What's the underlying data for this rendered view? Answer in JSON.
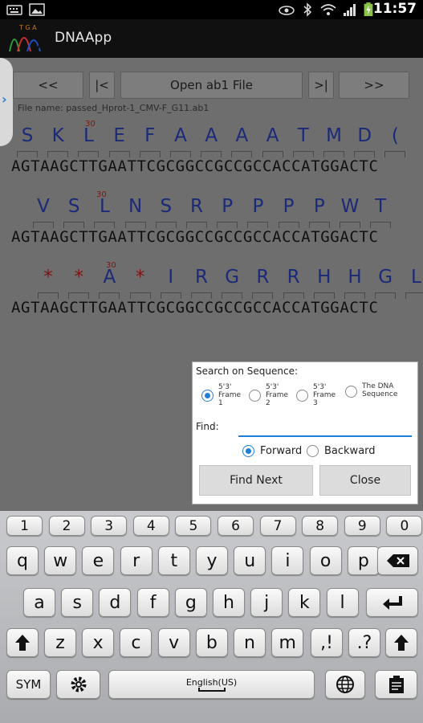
{
  "status_bar": {
    "time": "11:57",
    "icons": [
      "keyboard-icon",
      "image-icon",
      "eye-icon",
      "bluetooth-icon",
      "wifi-icon",
      "signal-icon",
      "battery-icon"
    ]
  },
  "app": {
    "title": "DNAApp",
    "logo_letters": "T G A"
  },
  "nav": {
    "first": "<<",
    "start": "|<",
    "open": "Open ab1 File",
    "end": ">|",
    "last": ">>"
  },
  "file_name": "File name: passed_Hprot-1_CMV-F_G11.ab1",
  "frames": [
    {
      "position_label": "30",
      "amino_acids": [
        "S",
        "K",
        "L",
        "E",
        "F",
        "A",
        "A",
        "A",
        "A",
        "T",
        "M",
        "D",
        "("
      ],
      "dna": "AGTAAGCTTGAATTCGCGGCCGCCGCCACCATGGACTC"
    },
    {
      "position_label": "30",
      "amino_acids": [
        "V",
        "S",
        "L",
        "N",
        "S",
        "R",
        "P",
        "P",
        "P",
        "P",
        "W",
        "T"
      ],
      "dna": "AGTAAGCTTGAATTCGCGGCCGCCGCCACCATGGACTC"
    },
    {
      "position_label": "30",
      "amino_acids": [
        "*",
        "*",
        "A",
        "*",
        "I",
        "R",
        "G",
        "R",
        "R",
        "H",
        "H",
        "G",
        "L"
      ],
      "dna": "AGTAAGCTTGAATTCGCGGCCGCCGCCACCATGGACTC"
    }
  ],
  "dialog": {
    "heading": "Search on Sequence:",
    "options": [
      {
        "line1": "5'3'",
        "line2": "Frame",
        "line3": "1",
        "selected": true
      },
      {
        "line1": "5'3'",
        "line2": "Frame",
        "line3": "2",
        "selected": false
      },
      {
        "line1": "5'3'",
        "line2": "Frame",
        "line3": "3",
        "selected": false
      },
      {
        "line1": "The DNA",
        "line2": "Sequence",
        "line3": "",
        "selected": false
      }
    ],
    "find_label": "Find:",
    "find_value": "",
    "forward_label": "Forward",
    "backward_label": "Backward",
    "direction": "Forward",
    "find_next": "Find Next",
    "close": "Close"
  },
  "keyboard": {
    "numbers": [
      "1",
      "2",
      "3",
      "4",
      "5",
      "6",
      "7",
      "8",
      "9",
      "0"
    ],
    "row1": [
      "q",
      "w",
      "e",
      "r",
      "t",
      "y",
      "u",
      "i",
      "o",
      "p"
    ],
    "row2": [
      "a",
      "s",
      "d",
      "f",
      "g",
      "h",
      "j",
      "k",
      "l"
    ],
    "row3": [
      "z",
      "x",
      "c",
      "v",
      "b",
      "n",
      "m"
    ],
    "punct1": ",!",
    "punct2": ".?",
    "sym": "SYM",
    "language": "English(US)"
  },
  "colors": {
    "accent": "#1f7ed6",
    "amino_acid": "#1b2a78",
    "stop": "#7d1515"
  }
}
